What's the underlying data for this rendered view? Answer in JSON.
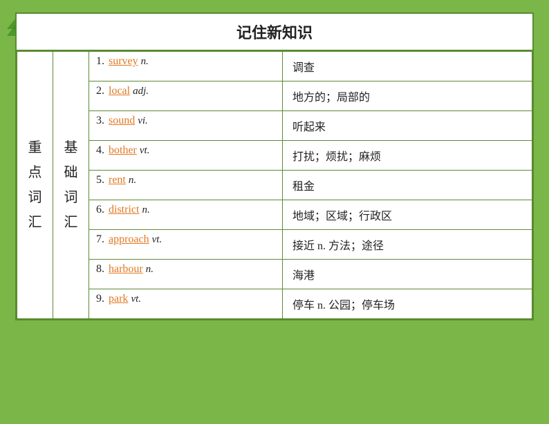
{
  "title": "记住新知识",
  "category": {
    "main": "重点词汇",
    "sub": "基础词汇"
  },
  "entries": [
    {
      "num": "1",
      "word": "survey",
      "pos": "n.",
      "meaning": "调查"
    },
    {
      "num": "2",
      "word": "local",
      "pos": "adj.",
      "meaning": "地方的；局部的"
    },
    {
      "num": "3",
      "word": "sound",
      "pos": "vi.",
      "meaning": "听起来"
    },
    {
      "num": "4",
      "word": "bother",
      "pos": "vt.",
      "meaning": "打扰；烦扰；麻烦"
    },
    {
      "num": "5",
      "word": "rent",
      "pos": "n.",
      "meaning": "租金"
    },
    {
      "num": "6",
      "word": "district",
      "pos": "n.",
      "meaning": "地域；区域；行政区"
    },
    {
      "num": "7",
      "word": "approach",
      "pos": "vt.",
      "meaning": "接近 n. 方法；途径"
    },
    {
      "num": "8",
      "word": "harbour",
      "pos": "n.",
      "meaning": "海港"
    },
    {
      "num": "9",
      "word": "park",
      "pos": "vt.",
      "meaning": "停车 n. 公园；停车场"
    }
  ],
  "colors": {
    "bg": "#7ab648",
    "border": "#5a8a30",
    "word": "#e07820"
  }
}
